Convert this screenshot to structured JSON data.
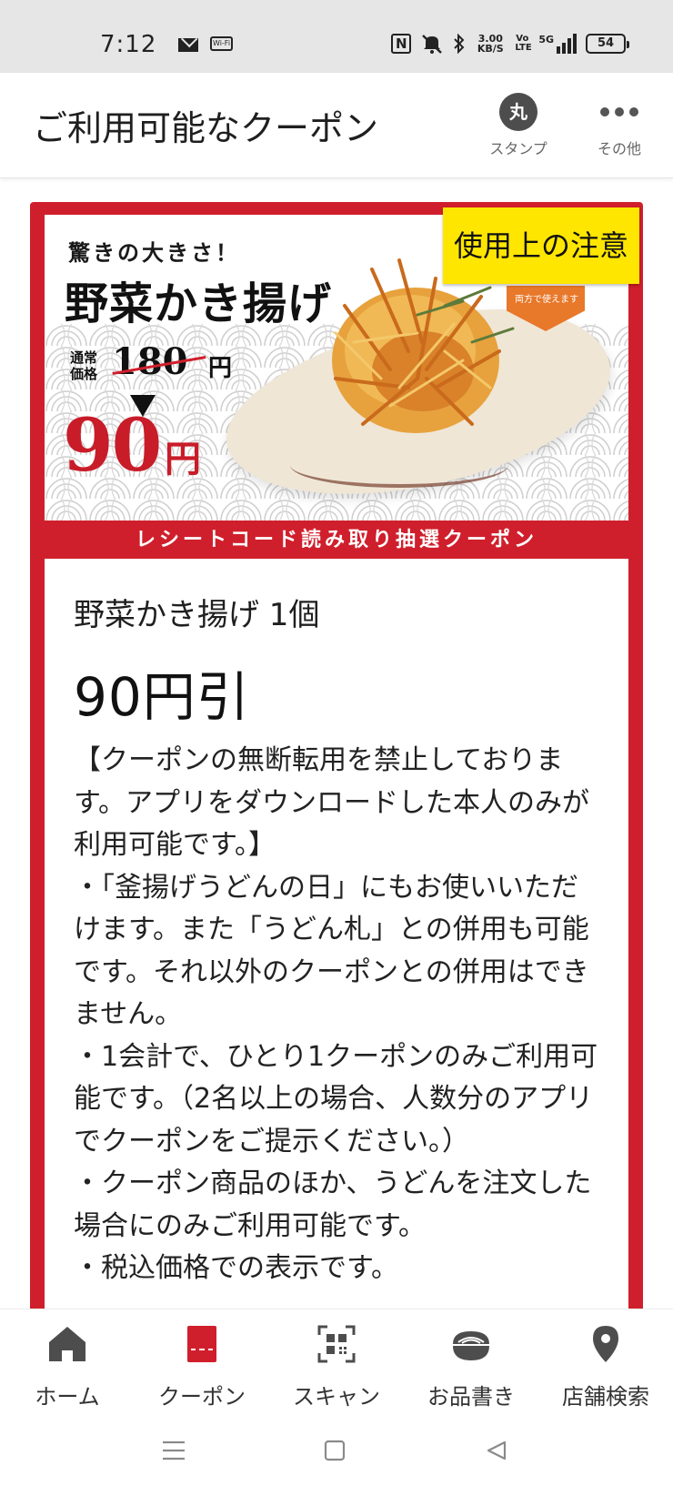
{
  "status_bar": {
    "time": "7:12",
    "wifi_label": "Wi-Fi",
    "nfc": "N",
    "speed": "3.00 KB/S",
    "volte": "Vo LTE",
    "network": "5G",
    "battery": "54"
  },
  "header": {
    "title": "ご利用可能なクーポン",
    "stamp_icon_text": "丸",
    "stamp_label": "スタンプ",
    "more_label": "その他"
  },
  "banner": {
    "tagline": "驚きの大きさ！",
    "product": "野菜かき揚げ",
    "regular_label": "通常価格",
    "regular_price": "180",
    "regular_yen": "円",
    "sale_price": "90",
    "sale_yen": "円",
    "badge": "両方で使えます",
    "caution_button": "使用上の注意",
    "strip": "レシートコード読み取り抽選クーポン"
  },
  "coupon": {
    "item": "野菜かき揚げ 1個",
    "discount": "90円引",
    "description": [
      "【クーポンの無断転用を禁止しております。アプリをダウンロードした本人のみが利用可能です。】",
      "・「釜揚げうどんの日」にもお使いいただけます。また「うどん札」との併用も可能です。それ以外のクーポンとの併用はできません。",
      "・1会計で、ひとり1クーポンのみご利用可能です。（2名以上の場合、人数分のアプリでクーポンをご提示ください。）",
      "・クーポン商品のほか、うどんを注文した場合にのみご利用可能です。",
      "・税込価格での表示です。"
    ]
  },
  "bottom_nav": {
    "items": [
      {
        "label": "ホーム",
        "icon": "home-icon"
      },
      {
        "label": "クーポン",
        "icon": "coupon-icon",
        "active": true
      },
      {
        "label": "スキャン",
        "icon": "qr-scan-icon"
      },
      {
        "label": "お品書き",
        "icon": "bowl-icon"
      },
      {
        "label": "店舗検索",
        "icon": "location-pin-icon"
      }
    ]
  },
  "colors": {
    "brand_red": "#d01f2c",
    "caution_yellow": "#ffe600",
    "icon_gray": "#4d4d4d"
  }
}
